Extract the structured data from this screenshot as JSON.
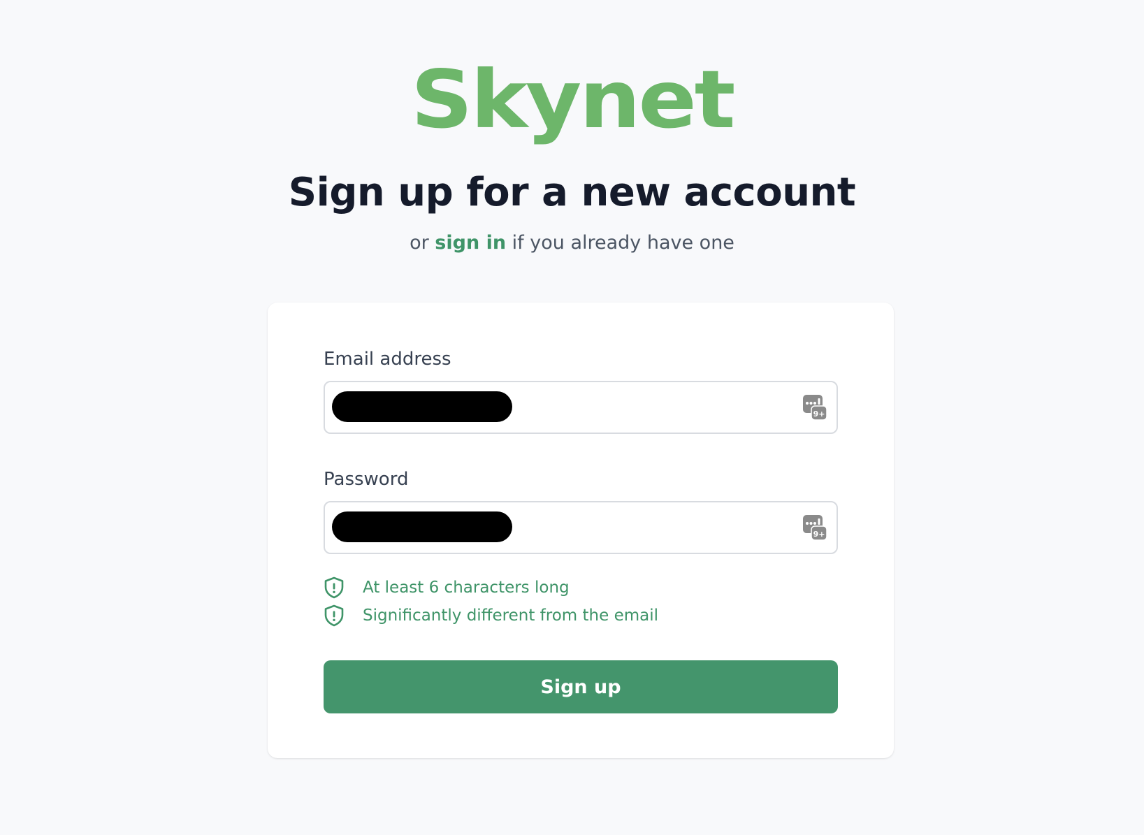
{
  "brand": {
    "logo_text": "Skynet",
    "color": "#6db66a"
  },
  "header": {
    "title": "Sign up for a new account",
    "subtitle_prefix": "or",
    "sign_in_link": "sign in",
    "subtitle_suffix": "if you already have one"
  },
  "form": {
    "email": {
      "label": "Email address",
      "value": "",
      "value_redacted": true
    },
    "password": {
      "label": "Password",
      "value": "",
      "value_redacted": true
    },
    "field_icon": "password-manager-icon",
    "requirements": [
      {
        "text": "At least 6 characters long",
        "icon": "shield-alert-icon"
      },
      {
        "text": "Significantly different from the email",
        "icon": "shield-alert-icon"
      }
    ],
    "submit_label": "Sign up"
  },
  "colors": {
    "accent_green": "#44956c",
    "link_green": "#3f9468",
    "title": "#151b2b",
    "background": "#f8f9fb"
  }
}
